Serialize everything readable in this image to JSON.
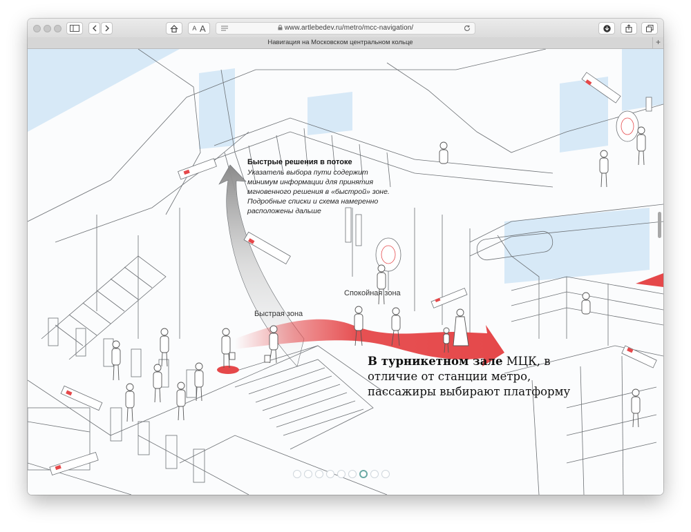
{
  "browser": {
    "url": "www.artlebedev.ru/metro/mcc-navigation/",
    "tab_title": "Навигация на Московском центральном кольце",
    "text_size_small": "A",
    "text_size_large": "A",
    "new_tab": "+"
  },
  "annotation": {
    "title": "Быстрые решения в потоке",
    "body": "Указатель выбора пути содержит минимум информации для принятия мгновенного решения в «быстрой» зоне. Подробные списки и схема намеренно расположены дальше"
  },
  "zones": {
    "fast": "Быстрая зона",
    "calm": "Спокойная зона"
  },
  "caption": {
    "bold": "В турникетном зале",
    "rest": " МЦК, в отличие от станции метро, пассажиры выбирают платформу"
  },
  "pager": {
    "count": 9,
    "active_index": 6
  },
  "colors": {
    "accent_red": "#e5484a",
    "glass_blue": "#d7e9f7",
    "line": "#6b6f73"
  }
}
